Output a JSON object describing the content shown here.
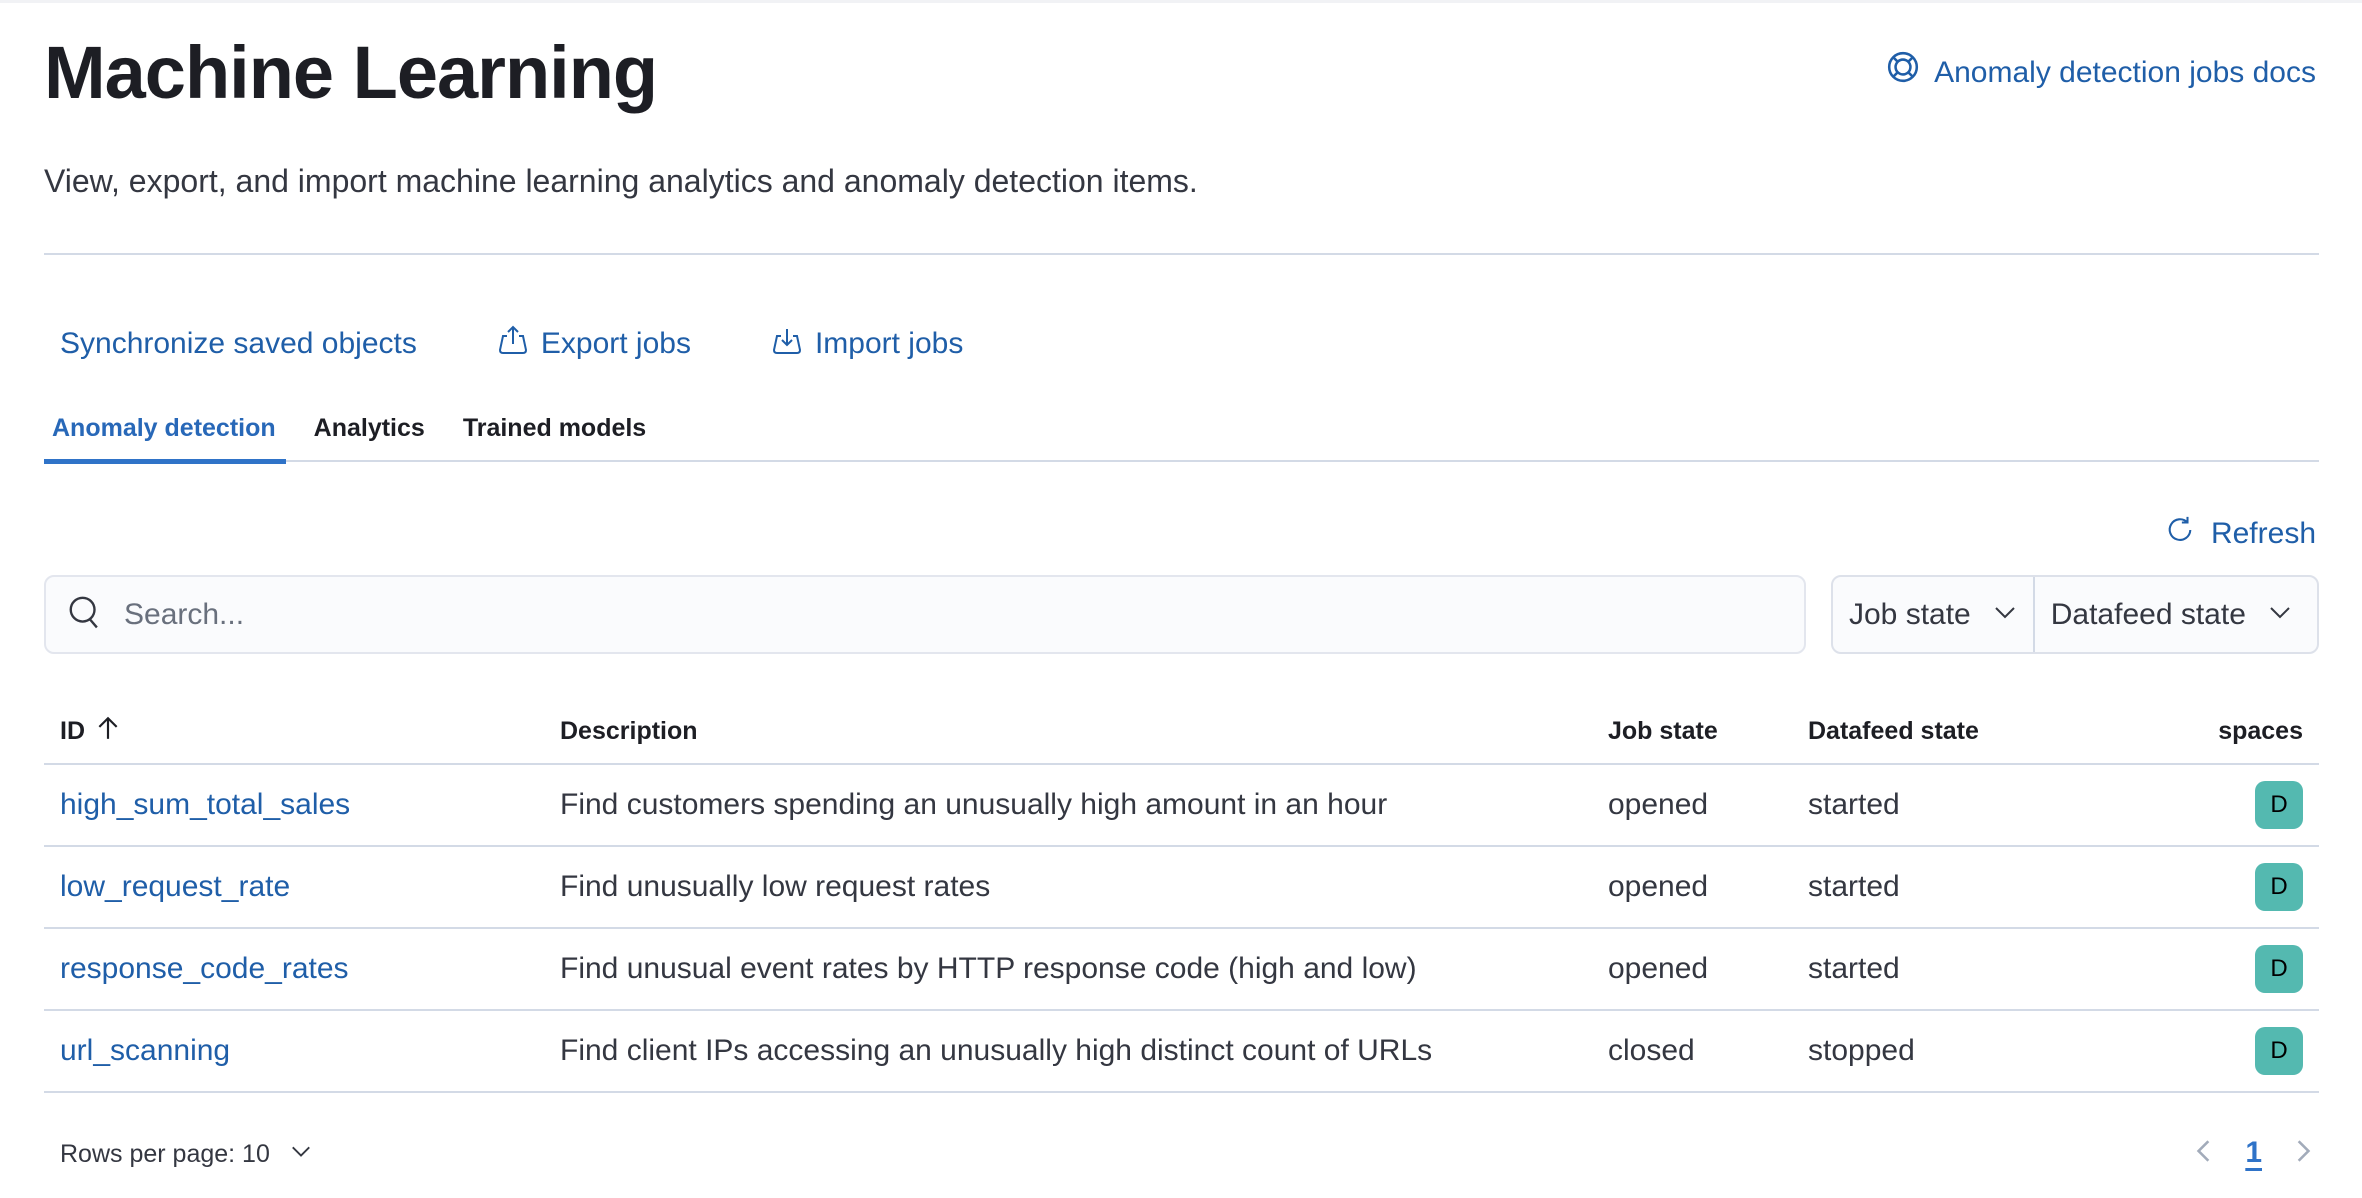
{
  "header": {
    "title": "Machine Learning",
    "subtitle": "View, export, and import machine learning analytics and anomaly detection items.",
    "docs_link": {
      "label": "Anomaly detection jobs docs",
      "icon": "help-lifebuoy-icon"
    }
  },
  "actions": [
    {
      "label": "Synchronize saved objects",
      "icon": null
    },
    {
      "label": "Export jobs",
      "icon": "export-icon"
    },
    {
      "label": "Import jobs",
      "icon": "import-icon"
    }
  ],
  "tabs": [
    {
      "label": "Anomaly detection",
      "active": true
    },
    {
      "label": "Analytics",
      "active": false
    },
    {
      "label": "Trained models",
      "active": false
    }
  ],
  "refresh": {
    "label": "Refresh",
    "icon": "refresh-icon"
  },
  "search": {
    "placeholder": "Search...",
    "value": ""
  },
  "filters": [
    {
      "label": "Job state"
    },
    {
      "label": "Datafeed state"
    }
  ],
  "table": {
    "columns": {
      "id": "ID",
      "description": "Description",
      "job_state": "Job state",
      "datafeed_state": "Datafeed state",
      "spaces": "spaces"
    },
    "sort": {
      "column": "id",
      "direction": "ascending"
    },
    "rows": [
      {
        "id": "high_sum_total_sales",
        "description": "Find customers spending an unusually high amount in an hour",
        "job_state": "opened",
        "datafeed_state": "started",
        "space": "D"
      },
      {
        "id": "low_request_rate",
        "description": "Find unusually low request rates",
        "job_state": "opened",
        "datafeed_state": "started",
        "space": "D"
      },
      {
        "id": "response_code_rates",
        "description": "Find unusual event rates by HTTP response code (high and low)",
        "job_state": "opened",
        "datafeed_state": "started",
        "space": "D"
      },
      {
        "id": "url_scanning",
        "description": "Find client IPs accessing an unusually high distinct count of URLs",
        "job_state": "closed",
        "datafeed_state": "stopped",
        "space": "D"
      }
    ]
  },
  "pagination": {
    "rows_per_page_label": "Rows per page: 10",
    "current_page": "1"
  },
  "colors": {
    "link": "#1f5ea8",
    "accent": "#2f73c8",
    "space_badge": "#54b9b0",
    "border": "#d3dae6"
  }
}
